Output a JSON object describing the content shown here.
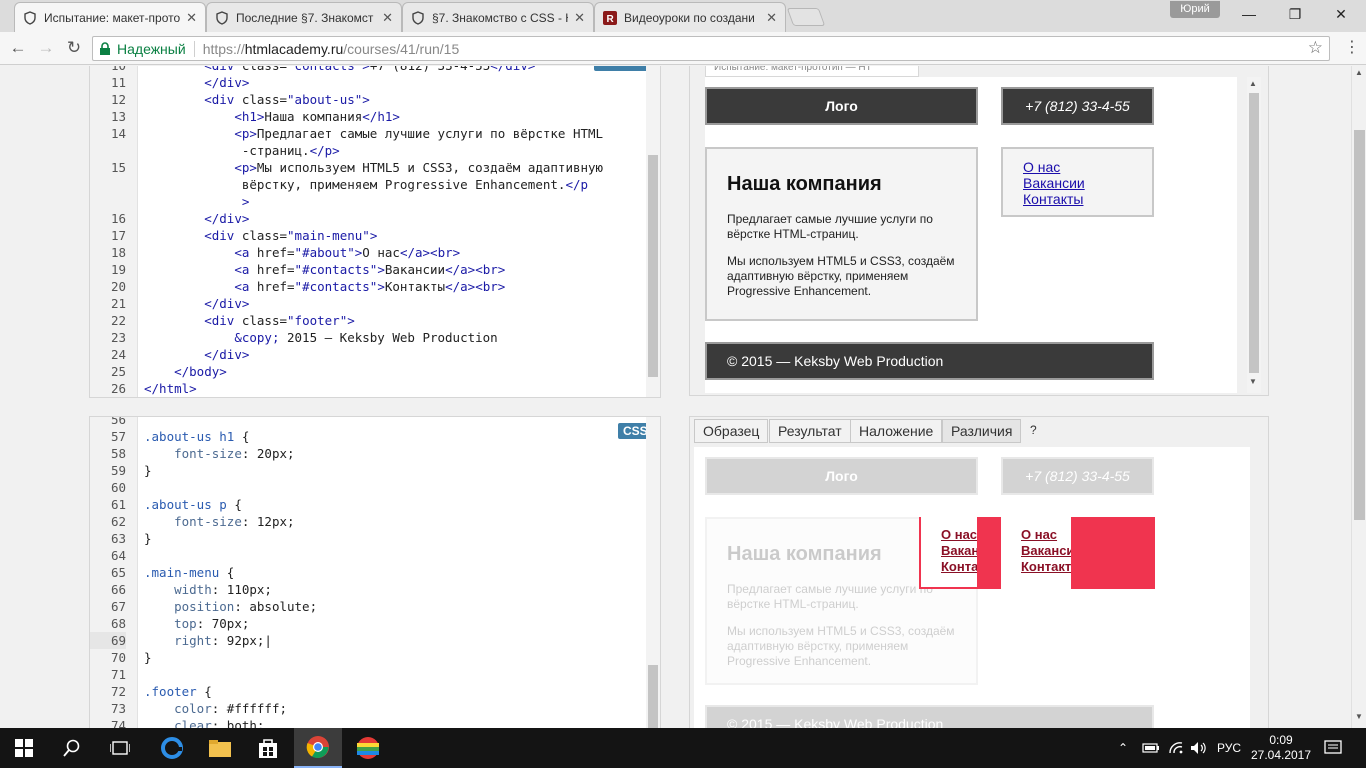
{
  "browser": {
    "tabs": [
      {
        "title": "Испытание: макет-прото",
        "active": true
      },
      {
        "title": "Последние §7. Знакомст",
        "active": false
      },
      {
        "title": "§7. Знакомство с CSS - H",
        "active": false
      },
      {
        "title": "Видеоуроки по создани",
        "active": false
      }
    ],
    "user_label": "Юрий",
    "omnibox": {
      "secure_label": "Надежный",
      "url_prefix": "https://",
      "url_host": "htmlacademy.ru",
      "url_path": "/courses/41/run/15"
    }
  },
  "html_editor": {
    "lines": [
      {
        "n": "10",
        "html": "        <span class='t-tag'>&lt;div</span> <span class='t-attr'>class=</span><span class='t-val'>\"contacts\"</span><span class='t-tag'>&gt;</span>+7 (812) 33-4-55<span class='t-tag'>&lt;/div&gt;</span>"
      },
      {
        "n": "11",
        "html": "        <span class='t-tag'>&lt;/div&gt;</span>"
      },
      {
        "n": "12",
        "html": "        <span class='t-tag'>&lt;div</span> <span class='t-attr'>class=</span><span class='t-val'>\"about-us\"</span><span class='t-tag'>&gt;</span>"
      },
      {
        "n": "13",
        "html": "            <span class='t-tag'>&lt;h1&gt;</span>Наша компания<span class='t-tag'>&lt;/h1&gt;</span>"
      },
      {
        "n": "14",
        "html": "            <span class='t-tag'>&lt;p&gt;</span>Предлагает самые лучшие услуги по вёрстке HTML"
      },
      {
        "n": "",
        "html": "             -страниц.<span class='t-tag'>&lt;/p&gt;</span>"
      },
      {
        "n": "15",
        "html": "            <span class='t-tag'>&lt;p&gt;</span>Мы используем HTML5 и CSS3, создаём адаптивную"
      },
      {
        "n": "",
        "html": "             вёрстку, применяем Progressive Enhancement.<span class='t-tag'>&lt;/p</span>"
      },
      {
        "n": "",
        "html": "             <span class='t-tag'>&gt;</span>"
      },
      {
        "n": "16",
        "html": "        <span class='t-tag'>&lt;/div&gt;</span>"
      },
      {
        "n": "17",
        "html": "        <span class='t-tag'>&lt;div</span> <span class='t-attr'>class=</span><span class='t-val'>\"main-menu\"</span><span class='t-tag'>&gt;</span>"
      },
      {
        "n": "18",
        "html": "            <span class='t-tag'>&lt;a</span> <span class='t-attr'>href=</span><span class='t-val'>\"#about\"</span><span class='t-tag'>&gt;</span>О нас<span class='t-tag'>&lt;/a&gt;&lt;br&gt;</span>"
      },
      {
        "n": "19",
        "html": "            <span class='t-tag'>&lt;a</span> <span class='t-attr'>href=</span><span class='t-val'>\"#contacts\"</span><span class='t-tag'>&gt;</span>Вакансии<span class='t-tag'>&lt;/a&gt;&lt;br&gt;</span>"
      },
      {
        "n": "20",
        "html": "            <span class='t-tag'>&lt;a</span> <span class='t-attr'>href=</span><span class='t-val'>\"#contacts\"</span><span class='t-tag'>&gt;</span>Контакты<span class='t-tag'>&lt;/a&gt;&lt;br&gt;</span>"
      },
      {
        "n": "21",
        "html": "        <span class='t-tag'>&lt;/div&gt;</span>"
      },
      {
        "n": "22",
        "html": "        <span class='t-tag'>&lt;div</span> <span class='t-attr'>class=</span><span class='t-val'>\"footer\"</span><span class='t-tag'>&gt;</span>"
      },
      {
        "n": "23",
        "html": "            <span class='t-val'>&amp;copy;</span> 2015 — Keksby Web Production"
      },
      {
        "n": "24",
        "html": "        <span class='t-tag'>&lt;/div&gt;</span>"
      },
      {
        "n": "25",
        "html": "    <span class='t-tag'>&lt;/body&gt;</span>"
      },
      {
        "n": "26",
        "html": "<span class='t-tag'>&lt;/html&gt;</span>"
      }
    ]
  },
  "css_editor": {
    "badge": "CSS",
    "lines": [
      {
        "n": "56",
        "html": ""
      },
      {
        "n": "57",
        "html": "<span class='t-sel'>.about-us h1</span> {"
      },
      {
        "n": "58",
        "html": "    <span class='t-prop'>font-size</span>: 20px;"
      },
      {
        "n": "59",
        "html": "}"
      },
      {
        "n": "60",
        "html": ""
      },
      {
        "n": "61",
        "html": "<span class='t-sel'>.about-us p</span> {"
      },
      {
        "n": "62",
        "html": "    <span class='t-prop'>font-size</span>: 12px;"
      },
      {
        "n": "63",
        "html": "}"
      },
      {
        "n": "64",
        "html": ""
      },
      {
        "n": "65",
        "html": "<span class='t-sel'>.main-menu</span> {"
      },
      {
        "n": "66",
        "html": "    <span class='t-prop'>width</span>: 110px;"
      },
      {
        "n": "67",
        "html": "    <span class='t-prop'>position</span>: absolute;"
      },
      {
        "n": "68",
        "html": "    <span class='t-prop'>top</span>: 70px;"
      },
      {
        "n": "69",
        "html": "    <span class='t-prop'>right</span>: 92px;|"
      },
      {
        "n": "70",
        "html": "}"
      },
      {
        "n": "71",
        "html": ""
      },
      {
        "n": "72",
        "html": "<span class='t-sel'>.footer</span> {"
      },
      {
        "n": "73",
        "html": "    <span class='t-prop'>color</span>: #ffffff;"
      },
      {
        "n": "74",
        "html": "    <span class='t-prop'>clear</span>: both;"
      }
    ]
  },
  "preview": {
    "top_tab": "Испытание: макет-прототип — НТ",
    "logo": "Лого",
    "phone": "+7 (812) 33-4-55",
    "h1": "Наша компания",
    "p1": "Предлагает самые лучшие услуги по вёрстке HTML-страниц.",
    "p2": "Мы используем HTML5 и CSS3, создаём адаптивную вёрстку, применяем Progressive Enhancement.",
    "menu": [
      "О нас",
      "Вакансии",
      "Контакты"
    ],
    "footer": "© 2015 — Keksby Web Production"
  },
  "compare": {
    "tabs": [
      "Образец",
      "Результат",
      "Наложение",
      "Различия",
      "?"
    ],
    "active_tab": "Различия",
    "overlap_fragments": [
      "О нас",
      "Ваканс",
      "Конта"
    ]
  },
  "taskbar": {
    "lang": "РУС",
    "time": "0:09",
    "date": "27.04.2017"
  },
  "colors": {
    "diff_red": "#f0344f",
    "secure_green": "#0b8043"
  }
}
